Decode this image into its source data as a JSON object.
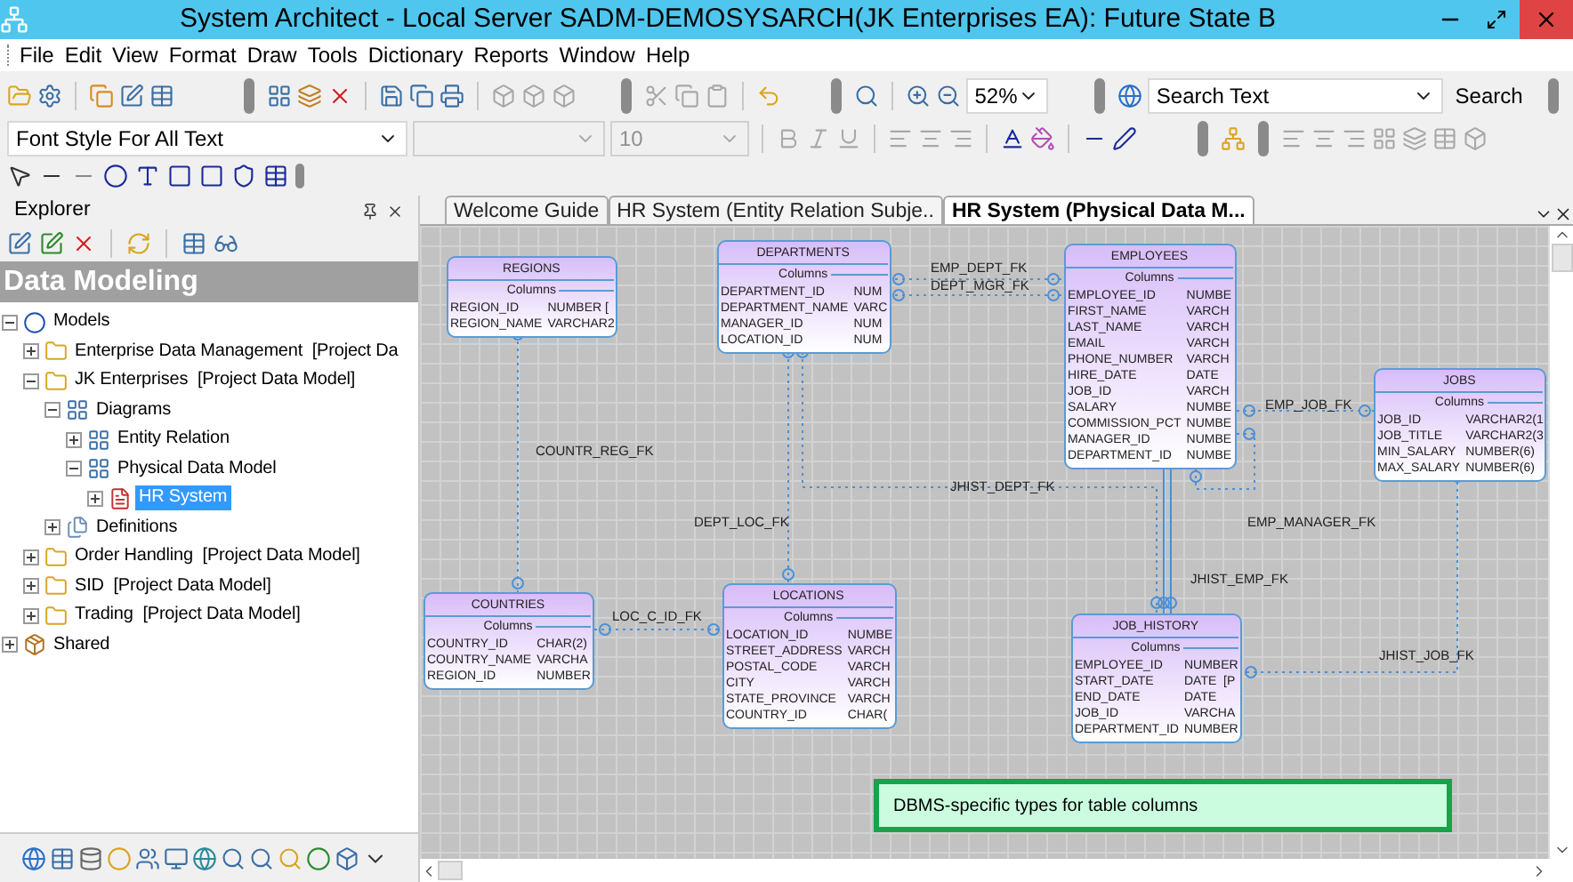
{
  "window": {
    "title": "System Architect - Local Server SADM-DEMOSYSARCH(JK Enterprises EA): Future State B"
  },
  "menu": [
    "File",
    "Edit",
    "View",
    "Format",
    "Draw",
    "Tools",
    "Dictionary",
    "Reports",
    "Window",
    "Help"
  ],
  "toolbar": {
    "zoom": "52%",
    "search": {
      "value": "Search Text",
      "button": "Search"
    },
    "font_style": "Font Style For All Text",
    "font_name": {
      "disabled": true
    },
    "font_size": {
      "value": "10",
      "disabled": true
    }
  },
  "explorer": {
    "title": "Explorer",
    "section": "Data Modeling",
    "tree": [
      {
        "label": "Models",
        "kind": "model",
        "expanded": true,
        "selected": false,
        "children": [
          {
            "label": "Enterprise Data Management  [Project Da",
            "kind": "folder",
            "expanded": false,
            "selected": false
          },
          {
            "label": "JK Enterprises  [Project Data Model]",
            "kind": "folder",
            "expanded": true,
            "selected": false,
            "children": [
              {
                "label": "Diagrams",
                "kind": "diagrams",
                "expanded": true,
                "selected": false,
                "children": [
                  {
                    "label": "Entity Relation",
                    "kind": "diagrams",
                    "expanded": false,
                    "selected": false
                  },
                  {
                    "label": "Physical Data Model",
                    "kind": "diagrams",
                    "expanded": true,
                    "selected": false,
                    "children": [
                      {
                        "label": "HR System",
                        "kind": "diagram",
                        "expanded": false,
                        "selected": true
                      }
                    ]
                  }
                ]
              },
              {
                "label": "Definitions",
                "kind": "definitions",
                "expanded": false,
                "selected": false
              }
            ]
          },
          {
            "label": "Order Handling  [Project Data Model]",
            "kind": "folder",
            "expanded": false,
            "selected": false
          },
          {
            "label": "SID  [Project Data Model]",
            "kind": "folder",
            "expanded": false,
            "selected": false
          },
          {
            "label": "Trading  [Project Data Model]",
            "kind": "folder",
            "expanded": false,
            "selected": false
          }
        ]
      },
      {
        "label": "Shared",
        "kind": "shared",
        "expanded": false,
        "selected": false
      }
    ]
  },
  "tabs": [
    {
      "label": "Welcome Guide",
      "selected": false
    },
    {
      "label": "HR System (Entity Relation Subje..",
      "selected": false
    },
    {
      "label": "HR System (Physical Data M...",
      "selected": true
    }
  ],
  "diagram": {
    "entities": [
      {
        "name": "REGIONS",
        "section": "Columns",
        "columns": [
          {
            "name": "REGION_ID",
            "type": "NUMBER ["
          },
          {
            "name": "REGION_NAME",
            "type": "VARCHAR2"
          }
        ]
      },
      {
        "name": "DEPARTMENTS",
        "section": "Columns",
        "columns": [
          {
            "name": "DEPARTMENT_ID",
            "type": "NUM"
          },
          {
            "name": "DEPARTMENT_NAME",
            "type": "VARC"
          },
          {
            "name": "MANAGER_ID",
            "type": "NUM"
          },
          {
            "name": "LOCATION_ID",
            "type": "NUM"
          }
        ]
      },
      {
        "name": "EMPLOYEES",
        "section": "Columns",
        "columns": [
          {
            "name": "EMPLOYEE_ID",
            "type": "NUMBE"
          },
          {
            "name": "FIRST_NAME",
            "type": "VARCH"
          },
          {
            "name": "LAST_NAME",
            "type": "VARCH"
          },
          {
            "name": "EMAIL",
            "type": "VARCH"
          },
          {
            "name": "PHONE_NUMBER",
            "type": "VARCH"
          },
          {
            "name": "HIRE_DATE",
            "type": "DATE"
          },
          {
            "name": "JOB_ID",
            "type": "VARCH"
          },
          {
            "name": "SALARY",
            "type": "NUMBE"
          },
          {
            "name": "COMMISSION_PCT",
            "type": "NUMBE"
          },
          {
            "name": "MANAGER_ID",
            "type": "NUMBE"
          },
          {
            "name": "DEPARTMENT_ID",
            "type": "NUMBE"
          }
        ]
      },
      {
        "name": "JOBS",
        "section": "Columns",
        "columns": [
          {
            "name": "JOB_ID",
            "type": "VARCHAR2(1"
          },
          {
            "name": "JOB_TITLE",
            "type": "VARCHAR2(3"
          },
          {
            "name": "MIN_SALARY",
            "type": "NUMBER(6)"
          },
          {
            "name": "MAX_SALARY",
            "type": "NUMBER(6)"
          }
        ]
      },
      {
        "name": "COUNTRIES",
        "section": "Columns",
        "columns": [
          {
            "name": "COUNTRY_ID",
            "type": "CHAR(2)"
          },
          {
            "name": "COUNTRY_NAME",
            "type": "VARCHA"
          },
          {
            "name": "REGION_ID",
            "type": "NUMBER"
          }
        ]
      },
      {
        "name": "LOCATIONS",
        "section": "Columns",
        "columns": [
          {
            "name": "LOCATION_ID",
            "type": "NUMBE"
          },
          {
            "name": "STREET_ADDRESS",
            "type": "VARCH"
          },
          {
            "name": "POSTAL_CODE",
            "type": "VARCH"
          },
          {
            "name": "CITY",
            "type": "VARCH"
          },
          {
            "name": "STATE_PROVINCE",
            "type": "VARCH"
          },
          {
            "name": "COUNTRY_ID",
            "type": "CHAR("
          }
        ]
      },
      {
        "name": "JOB_HISTORY",
        "section": "Columns",
        "columns": [
          {
            "name": "EMPLOYEE_ID",
            "type": "NUMBER"
          },
          {
            "name": "START_DATE",
            "type": "DATE  [P"
          },
          {
            "name": "END_DATE",
            "type": "DATE"
          },
          {
            "name": "JOB_ID",
            "type": "VARCHA"
          },
          {
            "name": "DEPARTMENT_ID",
            "type": "NUMBER"
          }
        ]
      }
    ],
    "relationships": [
      {
        "name": "EMP_DEPT_FK"
      },
      {
        "name": "DEPT_MGR_FK"
      },
      {
        "name": "COUNTR_REG_FK"
      },
      {
        "name": "DEPT_LOC_FK"
      },
      {
        "name": "JHIST_DEPT_FK"
      },
      {
        "name": "EMP_JOB_FK"
      },
      {
        "name": "EMP_MANAGER_FK"
      },
      {
        "name": "JHIST_EMP_FK"
      },
      {
        "name": "LOC_C_ID_FK"
      },
      {
        "name": "JHIST_JOB_FK"
      }
    ],
    "note": "DBMS-specific types for table columns"
  }
}
